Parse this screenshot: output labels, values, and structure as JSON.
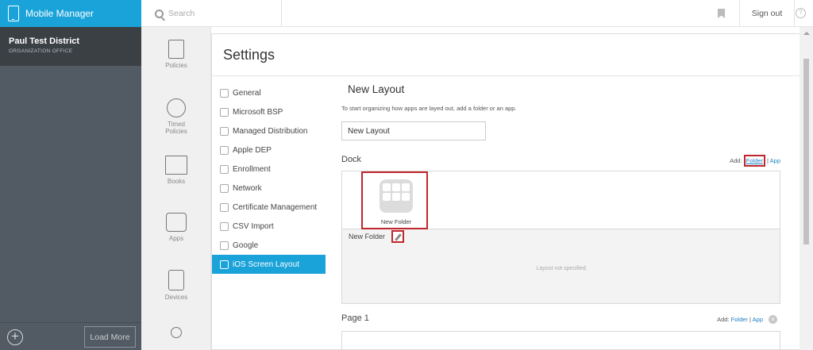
{
  "brand": {
    "title": "Mobile Manager"
  },
  "org": {
    "name": "Paul Test District",
    "subtitle": "ORGANIZATION OFFICE"
  },
  "left": {
    "load_more": "Load More"
  },
  "topbar": {
    "search_placeholder": "Search",
    "sign_out": "Sign out"
  },
  "nav": {
    "items": [
      {
        "label": "Policies"
      },
      {
        "label": "Timed Policies"
      },
      {
        "label": "Books"
      },
      {
        "label": "Apps"
      },
      {
        "label": "Devices"
      }
    ]
  },
  "settings": {
    "title": "Settings",
    "menu": [
      "General",
      "Microsoft BSP",
      "Managed Distribution",
      "Apple DEP",
      "Enrollment",
      "Network",
      "Certificate Management",
      "CSV Import",
      "Google",
      "iOS Screen Layout"
    ],
    "active_menu": "iOS Screen Layout"
  },
  "layout": {
    "title": "New Layout",
    "hint": "To start organizing how apps are layed out, add a folder or an app.",
    "name_value": "New Layout",
    "dock_label": "Dock",
    "add": "Add:",
    "folder_link": "Folder",
    "sep": "|",
    "app_link": "App",
    "folder_name": "New Folder",
    "selected_folder_label": "New Folder",
    "unspecified": "Layout not specified.",
    "page_label": "Page 1",
    "page_add": "Add:",
    "page_folder": "Folder",
    "page_app": "App"
  },
  "colors": {
    "accent": "#1aa3d9",
    "sidebar_dark": "#3b4045",
    "highlight": "#c0262d"
  }
}
